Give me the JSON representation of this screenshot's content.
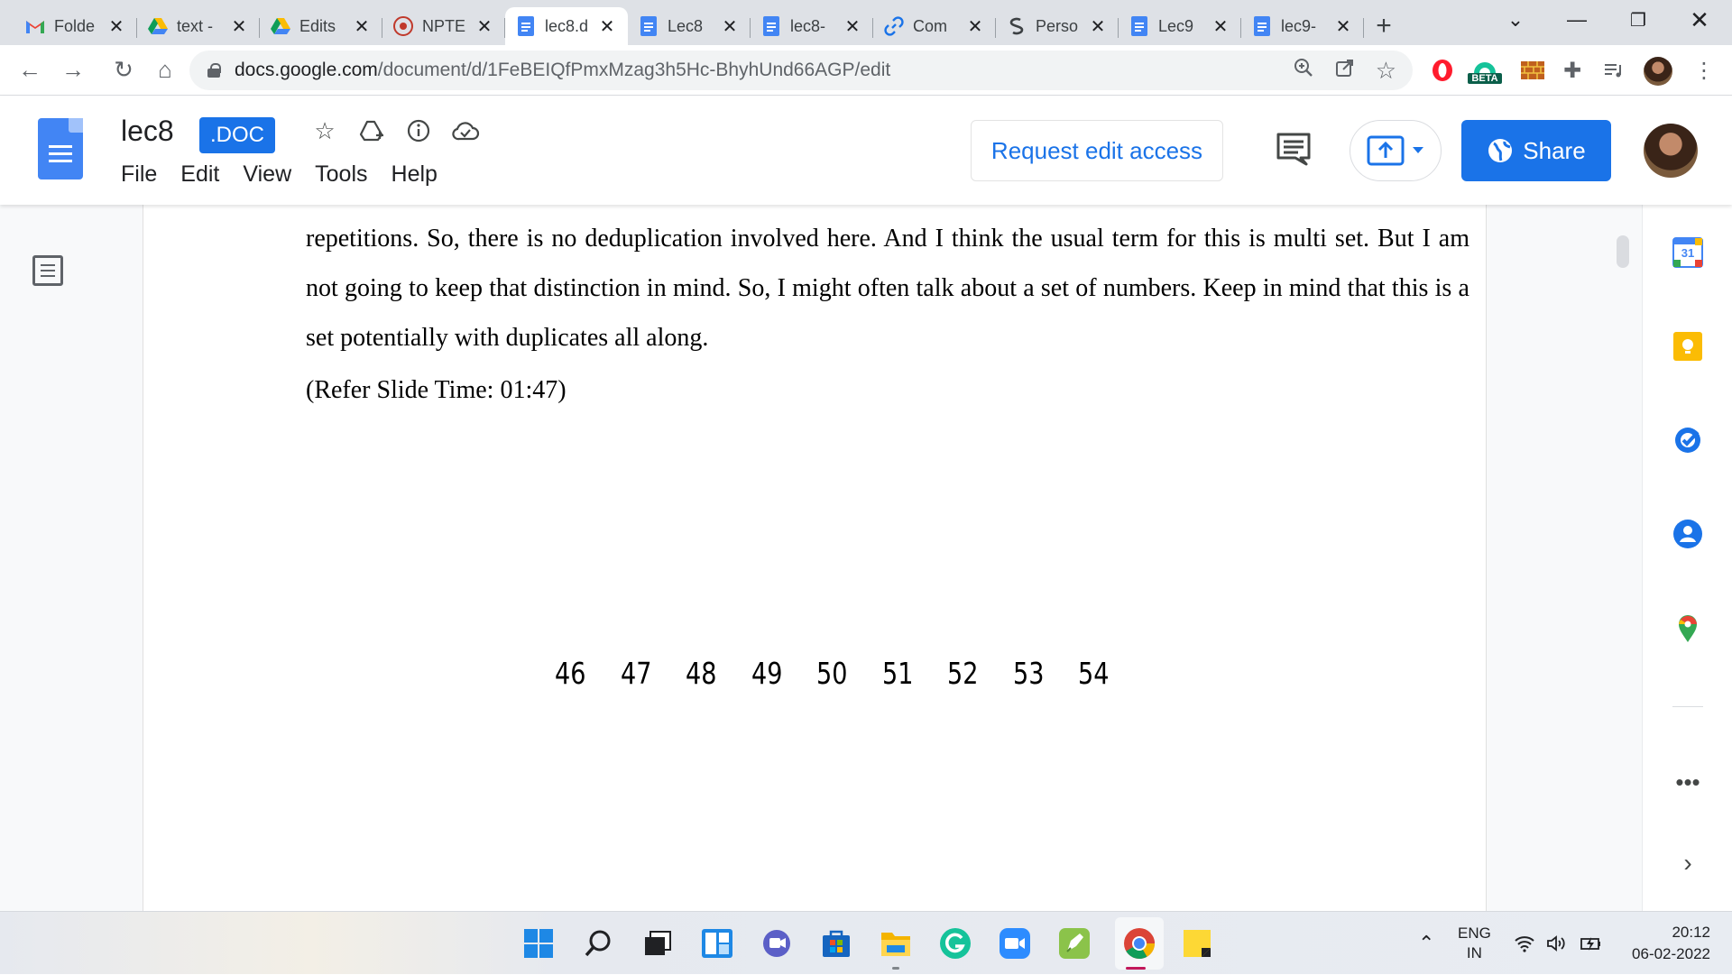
{
  "browser": {
    "tabs": [
      {
        "title": "Folde",
        "favicon": "gmail-icon",
        "active": false
      },
      {
        "title": "text -",
        "favicon": "drive-icon",
        "active": false
      },
      {
        "title": "Edits",
        "favicon": "drive-icon",
        "active": false
      },
      {
        "title": "NPTE",
        "favicon": "nptel-icon",
        "active": false
      },
      {
        "title": "lec8.d",
        "favicon": "docs-icon",
        "active": true
      },
      {
        "title": "Lec8",
        "favicon": "docs-icon",
        "active": false
      },
      {
        "title": "lec8-",
        "favicon": "docs-icon",
        "active": false
      },
      {
        "title": "Com",
        "favicon": "link-icon",
        "active": false
      },
      {
        "title": "Perso",
        "favicon": "perso-icon",
        "active": false
      },
      {
        "title": "Lec9",
        "favicon": "docs-icon",
        "active": false
      },
      {
        "title": "lec9-",
        "favicon": "docs-icon",
        "active": false
      }
    ],
    "url_host": "docs.google.com",
    "url_path": "/document/d/1FeBEIQfPmxMzag3h5Hc-BhyhUnd66AGP/edit",
    "extension_badge": "BETA"
  },
  "docs": {
    "title": "lec8",
    "badge": ".DOC",
    "menu": [
      "File",
      "Edit",
      "View",
      "Tools",
      "Help"
    ],
    "request_edit_label": "Request edit access",
    "share_label": "Share"
  },
  "document": {
    "paragraph": "repetitions. So, there is no deduplication involved here. And I think the usual term for this is multi set. But I am not going to keep that distinction in mind. So, I might often talk about a set of numbers. Keep in mind that this is a set potentially with duplicates all along.",
    "refer": "(Refer Slide Time: 01:47)",
    "numbers": [
      "46",
      "47",
      "48",
      "49",
      "50",
      "51",
      "52",
      "53",
      "54"
    ]
  },
  "side_panel": {
    "calendar_day": "31"
  },
  "taskbar": {
    "lang_top": "ENG",
    "lang_bottom": "IN",
    "time": "20:12",
    "date": "06-02-2022"
  },
  "colors": {
    "accent": "#1a73e8",
    "tabstrip": "#dee1e6"
  }
}
